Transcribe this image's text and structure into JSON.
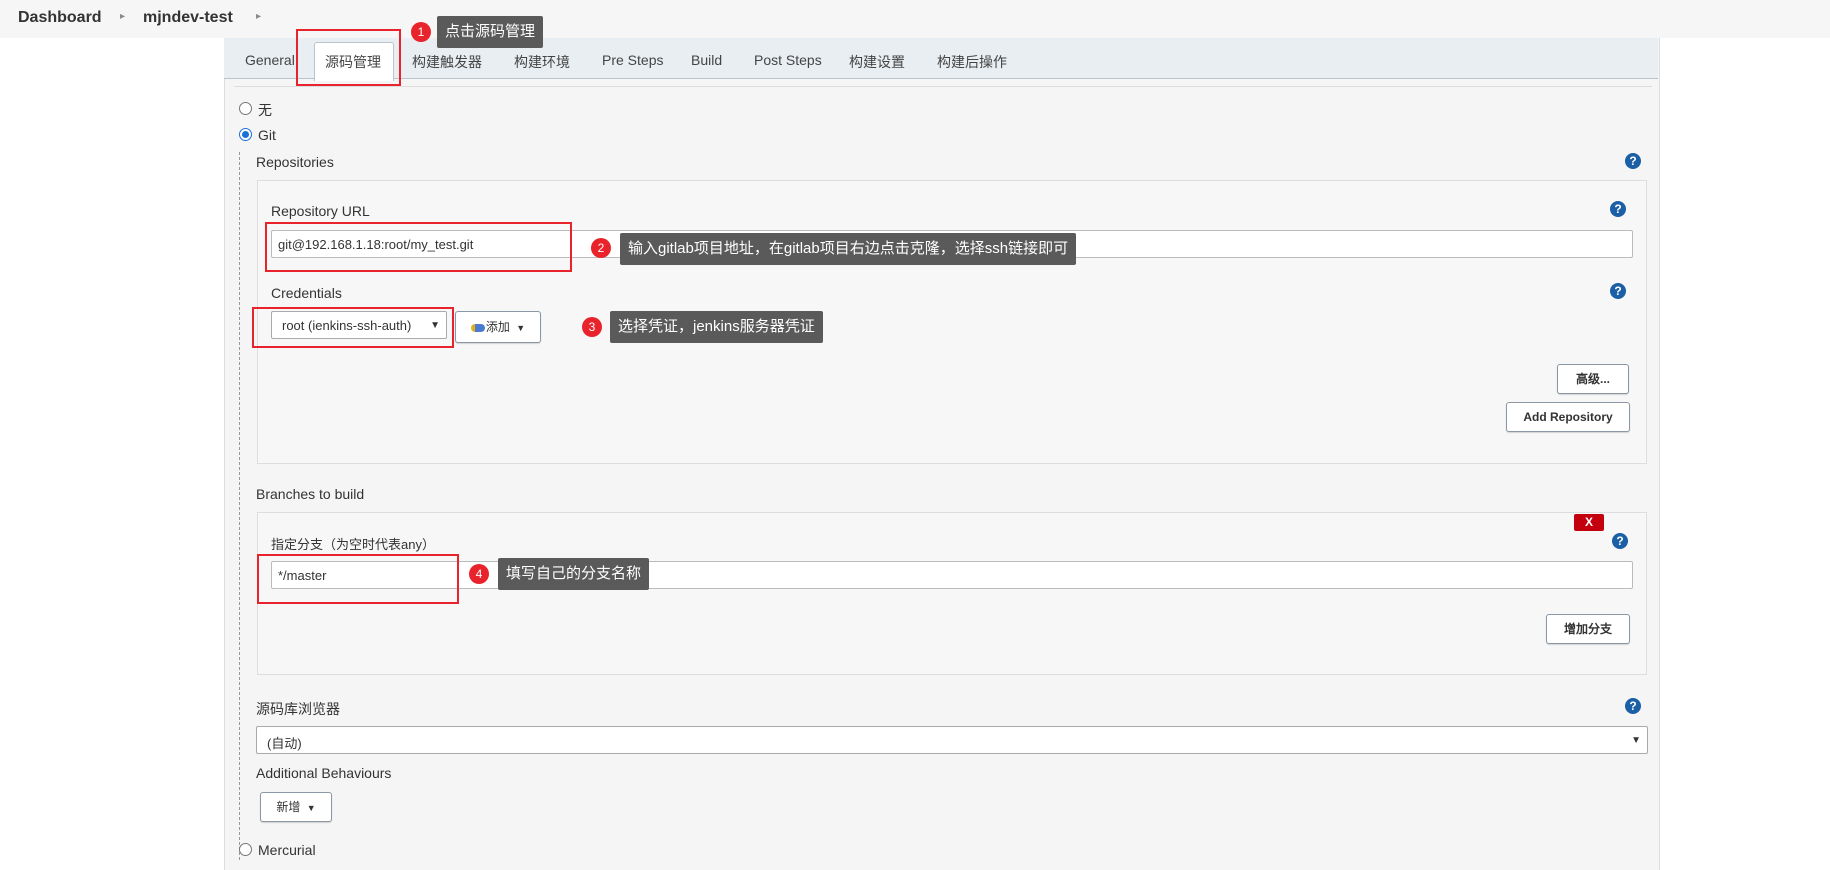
{
  "breadcrumb": {
    "dashboard": "Dashboard",
    "project": "mjndev-test"
  },
  "tabs": [
    "General",
    "源码管理",
    "构建触发器",
    "构建环境",
    "Pre Steps",
    "Build",
    "Post Steps",
    "构建设置",
    "构建后操作"
  ],
  "scm": {
    "options": {
      "none": "无",
      "git": "Git",
      "mercurial": "Mercurial"
    },
    "repositories_label": "Repositories",
    "repository_url_label": "Repository URL",
    "repository_url_value": "git@192.168.1.18:root/my_test.git",
    "credentials_label": "Credentials",
    "credentials_value": "root (ienkins-ssh-auth)",
    "add_button": "添加",
    "advanced_button": "高级...",
    "add_repository_button": "Add Repository",
    "branches_label": "Branches to build",
    "branch_specifier_label": "指定分支（为空时代表any）",
    "branch_value": "*/master",
    "delete_button": "X",
    "add_branch_button": "增加分支",
    "repo_browser_label": "源码库浏览器",
    "repo_browser_value": "(自动)",
    "additional_behaviours_label": "Additional Behaviours",
    "new_button": "新增"
  },
  "help_glyph": "?",
  "annotations": [
    {
      "num": "1",
      "text": "点击源码管理"
    },
    {
      "num": "2",
      "text": "输入gitlab项目地址，在gitlab项目右边点击克隆，选择ssh链接即可"
    },
    {
      "num": "3",
      "text": "选择凭证，jenkins服务器凭证"
    },
    {
      "num": "4",
      "text": "填写自己的分支名称"
    }
  ],
  "colors": {
    "annotation_red": "#e8232b",
    "tooltip_bg": "#5a5a5a",
    "help_blue": "#1b5fa6",
    "delete_red": "#c4000e"
  }
}
